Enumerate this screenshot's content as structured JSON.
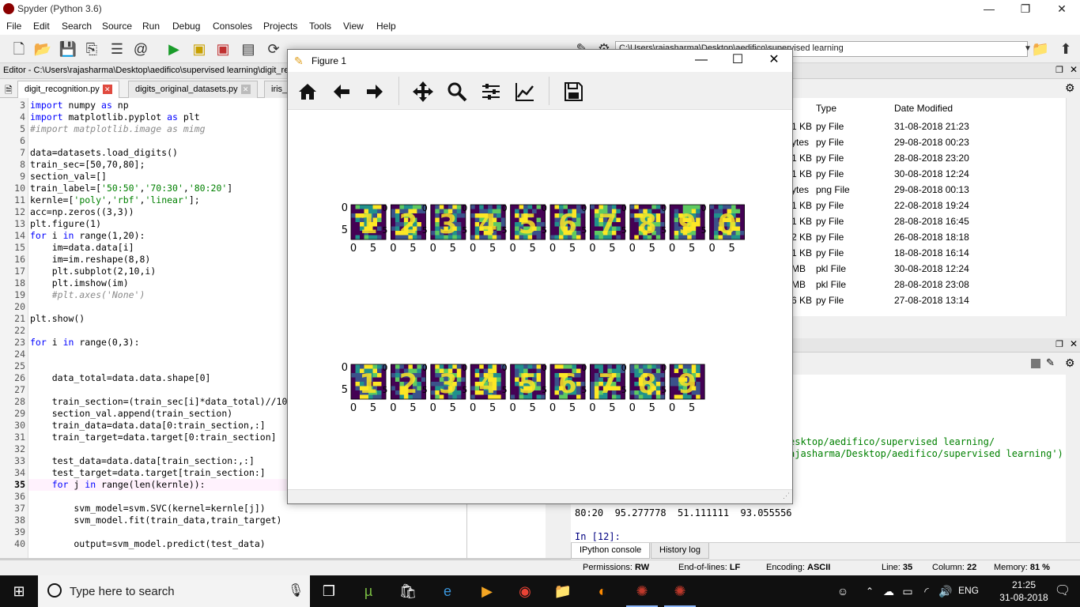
{
  "window": {
    "title": "Spyder (Python 3.6)",
    "min": "—",
    "restore": "❐",
    "close": "✕"
  },
  "menu": [
    "File",
    "Edit",
    "Search",
    "Source",
    "Run",
    "Debug",
    "Consoles",
    "Projects",
    "Tools",
    "View",
    "Help"
  ],
  "toolbar": {
    "path": "C:\\Users\\rajasharma\\Desktop\\aedifico\\supervised learning"
  },
  "editor": {
    "title": "Editor - C:\\Users\\rajasharma\\Desktop\\aedifico\\supervised learning\\digit_re",
    "tabs": [
      "digit_recognition.py",
      "digits_original_datasets.py",
      "iris_"
    ],
    "current_line": 35,
    "lines": [
      {
        "n": "3",
        "t": "import numpy as np"
      },
      {
        "n": "4",
        "t": "import matplotlib.pyplot as plt"
      },
      {
        "n": "5",
        "t": "#import matplotlib.image as mimg"
      },
      {
        "n": "6",
        "t": ""
      },
      {
        "n": "7",
        "t": "data=datasets.load_digits()"
      },
      {
        "n": "8",
        "t": "train_sec=[50,70,80];"
      },
      {
        "n": "9",
        "t": "section_val=[]"
      },
      {
        "n": "10",
        "t": "train_label=['50:50','70:30','80:20']"
      },
      {
        "n": "11",
        "t": "kernle=['poly','rbf','linear'];"
      },
      {
        "n": "12",
        "t": "acc=np.zeros((3,3))"
      },
      {
        "n": "13",
        "t": "plt.figure(1)"
      },
      {
        "n": "14",
        "t": "for i in range(1,20):"
      },
      {
        "n": "15",
        "t": "    im=data.data[i]"
      },
      {
        "n": "16",
        "t": "    im=im.reshape(8,8)"
      },
      {
        "n": "17",
        "t": "    plt.subplot(2,10,i)"
      },
      {
        "n": "18",
        "t": "    plt.imshow(im)"
      },
      {
        "n": "19",
        "t": "    #plt.axes('None')"
      },
      {
        "n": "20",
        "t": ""
      },
      {
        "n": "21",
        "t": "plt.show()"
      },
      {
        "n": "22",
        "t": ""
      },
      {
        "n": "23",
        "t": "for i in range(0,3):"
      },
      {
        "n": "24",
        "t": ""
      },
      {
        "n": "25",
        "t": ""
      },
      {
        "n": "26",
        "t": "    data_total=data.data.shape[0]"
      },
      {
        "n": "27",
        "t": ""
      },
      {
        "n": "28",
        "t": "    train_section=(train_sec[i]*data_total)//10"
      },
      {
        "n": "29",
        "t": "    section_val.append(train_section)"
      },
      {
        "n": "30",
        "t": "    train_data=data.data[0:train_section,:]"
      },
      {
        "n": "31",
        "t": "    train_target=data.target[0:train_section]"
      },
      {
        "n": "32",
        "t": ""
      },
      {
        "n": "33",
        "t": "    test_data=data.data[train_section:,:]"
      },
      {
        "n": "34",
        "t": "    test_target=data.target[train_section:]"
      },
      {
        "n": "35",
        "t": "    for j in range(len(kernle)):"
      },
      {
        "n": "36",
        "t": ""
      },
      {
        "n": "37",
        "t": "        svm_model=svm.SVC(kernel=kernle[j])"
      },
      {
        "n": "38",
        "t": "        svm_model.fit(train_data,train_target)"
      },
      {
        "n": "39",
        "t": ""
      },
      {
        "n": "40",
        "t": "        output=svm_model.predict(test_data)"
      }
    ]
  },
  "file_explorer": {
    "columns": [
      "Type",
      "Date Modified"
    ],
    "rows": [
      {
        "size": "1 KB",
        "type": "py File",
        "date": "31-08-2018 21:23"
      },
      {
        "size": "ytes",
        "type": "py File",
        "date": "29-08-2018 00:23"
      },
      {
        "size": "1 KB",
        "type": "py File",
        "date": "28-08-2018 23:20"
      },
      {
        "size": "1 KB",
        "type": "py File",
        "date": "30-08-2018 12:24"
      },
      {
        "size": "ytes",
        "type": "png File",
        "date": "29-08-2018 00:13"
      },
      {
        "size": "1 KB",
        "type": "py File",
        "date": "22-08-2018 19:24"
      },
      {
        "size": "1 KB",
        "type": "py File",
        "date": "28-08-2018 16:45"
      },
      {
        "size": "2 KB",
        "type": "py File",
        "date": "26-08-2018 18:18"
      },
      {
        "size": "1 KB",
        "type": "py File",
        "date": "18-08-2018 16:14"
      },
      {
        "size": "MB",
        "type": "pkl File",
        "date": "30-08-2018 12:24"
      },
      {
        "size": "MB",
        "type": "pkl File",
        "date": "28-08-2018 23:08"
      },
      {
        "size": "6 KB",
        "type": "py File",
        "date": "27-08-2018 13:14"
      }
    ]
  },
  "console": {
    "line1": "esktop/aedifico/supervised learning/",
    "line2": "ajasharma/Desktop/aedifico/supervised learning')",
    "result": "80:20  95.277778  51.111111  93.055556",
    "prompt": "In [12]:",
    "tabs": [
      "IPython console",
      "History log"
    ]
  },
  "status": {
    "permissions_label": "Permissions:",
    "permissions": "RW",
    "eol_label": "End-of-lines:",
    "eol": "LF",
    "encoding_label": "Encoding:",
    "encoding": "ASCII",
    "line_label": "Line:",
    "line": "35",
    "column_label": "Column:",
    "column": "22",
    "memory_label": "Memory:",
    "memory": "81 %"
  },
  "taskbar": {
    "search_placeholder": "Type here to search",
    "lang": "ENG",
    "time": "21:25",
    "date": "31-08-2018"
  },
  "figure": {
    "title": "Figure 1",
    "row1_digits": [
      "1",
      "2",
      "3",
      "4",
      "5",
      "6",
      "7",
      "8",
      "9",
      "0"
    ],
    "row2_digits": [
      "1",
      "2",
      "3",
      "4",
      "5",
      "6",
      "7",
      "8",
      "9"
    ],
    "y_ticks": [
      "0",
      "5"
    ],
    "x_ticks": [
      "0",
      "5"
    ],
    "colors": {
      "dark": "#440154",
      "mid": "#3b528b",
      "teal": "#21918c",
      "green": "#5ec962",
      "bright": "#fde725"
    }
  }
}
